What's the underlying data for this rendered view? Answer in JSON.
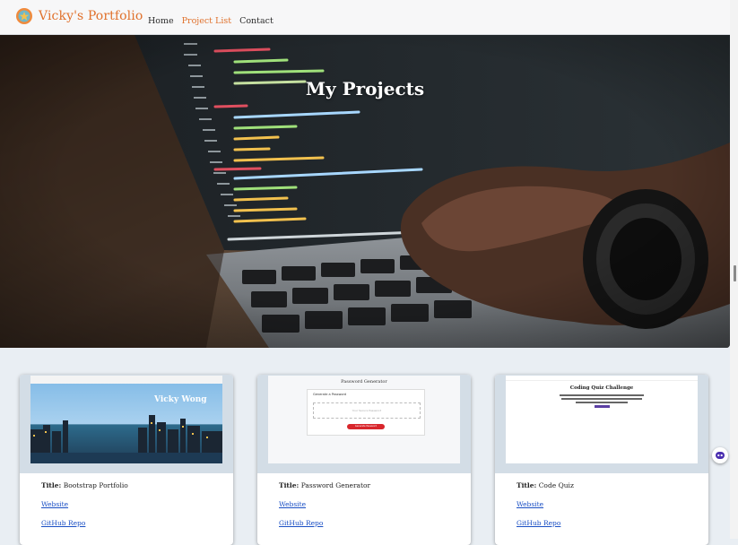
{
  "navbar": {
    "brand": "Vicky's Portfolio",
    "links": [
      {
        "label": "Home",
        "active": false
      },
      {
        "label": "Project List",
        "active": true
      },
      {
        "label": "Contact",
        "active": false
      }
    ]
  },
  "hero": {
    "title": "My Projects"
  },
  "projects": [
    {
      "title_label": "Title:",
      "title": "Bootstrap Portfolio",
      "website_label": "Website",
      "repo_label": "GitHub Repo",
      "thumb": {
        "heading": "Vicky Wong"
      }
    },
    {
      "title_label": "Title:",
      "title": "Password Generator",
      "website_label": "Website",
      "repo_label": "GitHub Repo",
      "thumb": {
        "heading": "Password Generator",
        "subheading": "Generate a Password",
        "placeholder": "Your Secure Password",
        "button": "Generate Password"
      }
    },
    {
      "title_label": "Title:",
      "title": "Code Quiz",
      "website_label": "Website",
      "repo_label": "GitHub Repo",
      "thumb": {
        "heading": "Coding Quiz Challenge"
      }
    }
  ],
  "colors": {
    "accent": "#e0712c",
    "link": "#1a4fc4"
  },
  "icons": {
    "brand": "star-logo-icon",
    "chat": "chat-bot-icon"
  }
}
